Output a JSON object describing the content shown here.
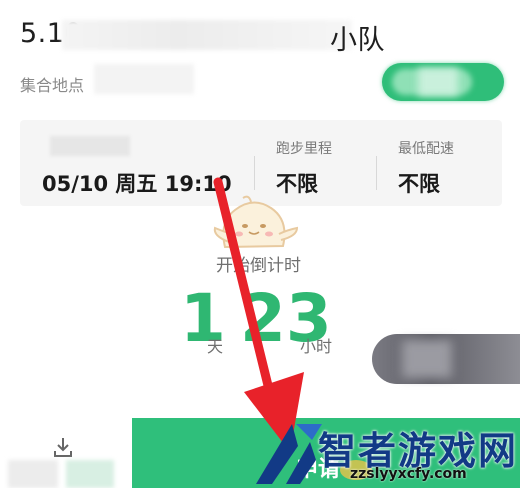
{
  "header": {
    "title_prefix": "5.10",
    "title_suffix": "小队",
    "meeting_point_label": "集合地点"
  },
  "info": {
    "time_value": "05/10 周五 19:10",
    "distance_label": "跑步里程",
    "distance_value": "不限",
    "pace_label": "最低配速",
    "pace_value": "不限"
  },
  "countdown": {
    "label": "开始倒计时",
    "days": "1",
    "days_unit": "天",
    "hours": "23",
    "hours_unit": "小时"
  },
  "bottom": {
    "join_label": "申请"
  },
  "watermark": {
    "text": "智者游戏网",
    "url": "zzslyyxcfy.com"
  },
  "colors": {
    "accent_green": "#2fbf7b",
    "arrow_red": "#e8222a",
    "watermark_blue": "#123a86"
  },
  "icons": [
    "download-icon",
    "mascot-icon",
    "watermark-logo-icon"
  ]
}
